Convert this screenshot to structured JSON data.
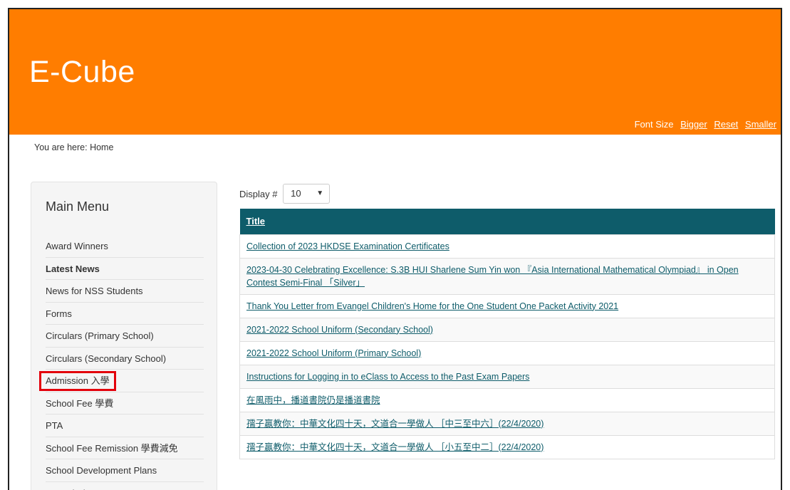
{
  "header": {
    "site_title": "E-Cube",
    "font_size_label": "Font Size",
    "bigger": "Bigger",
    "reset": "Reset",
    "smaller": "Smaller"
  },
  "breadcrumb": "You are here: Home",
  "sidebar": {
    "title": "Main Menu",
    "items": [
      {
        "label": "Award Winners"
      },
      {
        "label": "Latest News"
      },
      {
        "label": "News for NSS Students"
      },
      {
        "label": "Forms"
      },
      {
        "label": "Circulars (Primary School)"
      },
      {
        "label": "Circulars (Secondary School)"
      },
      {
        "label": "Admission 入學"
      },
      {
        "label": "School Fee 學費"
      },
      {
        "label": "PTA"
      },
      {
        "label": "School Fee Remission 學費減免"
      },
      {
        "label": "School Development Plans"
      },
      {
        "label": "Annual Plans"
      }
    ]
  },
  "display": {
    "label": "Display #",
    "value": "10"
  },
  "table": {
    "header": "Title",
    "rows": [
      "Collection of 2023 HKDSE Examination Certificates",
      "2023-04-30 Celebrating Excellence: S.3B HUI Sharlene Sum Yin won 『Asia International Mathematical Olympiad』 in Open Contest Semi-Final 「Silver」",
      "Thank You Letter from Evangel Children's Home for the One Student One Packet Activity 2021",
      "2021-2022 School Uniform (Secondary School)",
      "2021-2022 School Uniform (Primary School)",
      "Instructions for Logging in to eClass to Access to the Past Exam Papers",
      "在風雨中，播道書院仍是播道書院",
      "孺子贏教你：中華文化四十天，文道合一學做人 ［中三至中六］(22/4/2020)",
      "孺子贏教你：中華文化四十天，文道合一學做人 ［小五至中二］(22/4/2020)"
    ]
  }
}
